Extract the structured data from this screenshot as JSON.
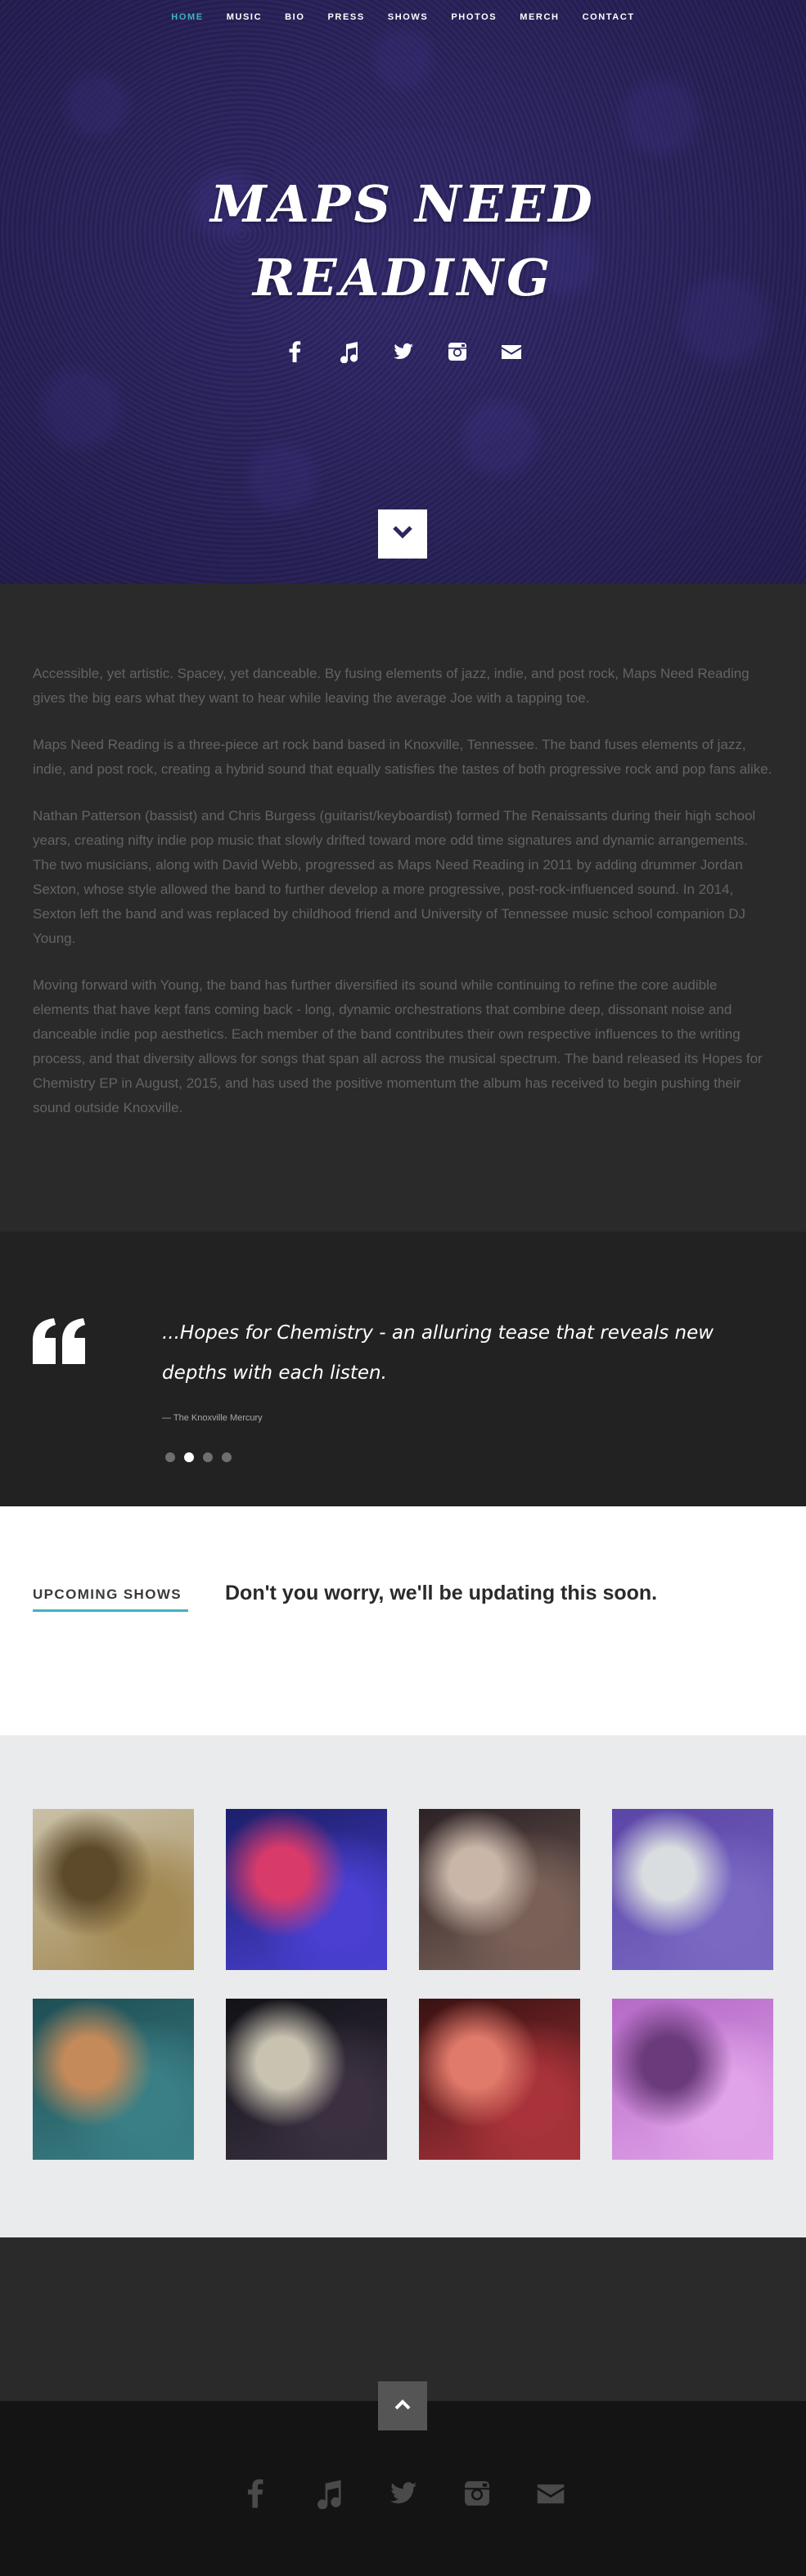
{
  "nav": {
    "items": [
      {
        "label": "HOME",
        "active": true
      },
      {
        "label": "MUSIC"
      },
      {
        "label": "BIO"
      },
      {
        "label": "PRESS"
      },
      {
        "label": "SHOWS"
      },
      {
        "label": "PHOTOS"
      },
      {
        "label": "MERCH"
      },
      {
        "label": "CONTACT"
      }
    ],
    "active_color": "#3fb2c2"
  },
  "hero": {
    "title_line1": "Maps Need",
    "title_line2": "Reading",
    "social_icons": [
      "facebook-icon",
      "music-note-icon",
      "twitter-icon",
      "instagram-icon",
      "envelope-icon"
    ]
  },
  "about": {
    "paragraphs": [
      "Accessible, yet artistic. Spacey, yet danceable. By fusing elements of jazz, indie, and post rock, Maps Need Reading gives the big ears what they want to hear while leaving the average Joe with a tapping toe.",
      "Maps Need Reading is a three-piece art rock band based in Knoxville, Tennessee. The band fuses elements of jazz, indie, and post rock, creating a hybrid sound that equally satisfies the tastes of both progressive rock and pop fans alike.",
      "Nathan Patterson (bassist) and Chris Burgess (guitarist/keyboardist) formed The Renaissants during their high school years, creating nifty indie pop music that slowly drifted toward more odd time signatures and dynamic arrangements. The two musicians, along with David Webb, progressed as Maps Need Reading in 2011 by adding drummer Jordan Sexton, whose style allowed the band to further develop a more progressive, post-rock-influenced sound. In 2014, Sexton left the band and was replaced by childhood friend and University of Tennessee music school companion DJ Young.",
      "Moving forward with Young, the band has further diversified its sound while continuing to refine the core audible elements that have kept fans coming back - long, dynamic orchestrations that combine deep, dissonant noise and danceable indie pop aesthetics. Each member of the band contributes their own respective influences to the writing process, and that diversity allows for songs that span all across the musical spectrum. The band released its Hopes for Chemistry EP in August, 2015, and has used the positive momentum the album has received to begin pushing their sound outside Knoxville."
    ]
  },
  "quote": {
    "text": "...Hopes for Chemistry - an alluring tease that reveals new depths with each listen.",
    "cite": "— The Knoxville Mercury",
    "dot_count": 4,
    "active_dot": 2
  },
  "shows": {
    "heading": "UPCOMING SHOWS",
    "message": "Don't you worry, we'll be updating this soon."
  },
  "gallery": {
    "photos": [
      {
        "name": "band-field-photo",
        "colors": [
          "#c9c0a8",
          "#a38a54",
          "#5d4a2a"
        ]
      },
      {
        "name": "live-blue-stage-photo",
        "colors": [
          "#1c1f6b",
          "#4a3fd1",
          "#d83a6a"
        ]
      },
      {
        "name": "guitarist-closeup-photo",
        "colors": [
          "#2c2226",
          "#7a6158",
          "#c9b6a8"
        ]
      },
      {
        "name": "merch-shirts-photo",
        "colors": [
          "#5b45a8",
          "#7a68c2",
          "#d9dde0"
        ]
      },
      {
        "name": "guitar-on-rug-photo",
        "colors": [
          "#1e4f55",
          "#3a7f85",
          "#c48a5a"
        ]
      },
      {
        "name": "live-bar-stage-photo",
        "colors": [
          "#121218",
          "#3a3040",
          "#c8c2b0"
        ]
      },
      {
        "name": "red-stage-gear-photo",
        "colors": [
          "#3a1212",
          "#a8333a",
          "#e07a6a"
        ]
      },
      {
        "name": "pink-live-photo",
        "colors": [
          "#b56ac7",
          "#e0a2e8",
          "#6a3a7a"
        ]
      }
    ]
  },
  "footer": {
    "social_icons": [
      "facebook-icon",
      "music-note-icon",
      "twitter-icon",
      "instagram-icon",
      "envelope-icon"
    ]
  },
  "colors": {
    "accent": "#3fb2c2",
    "hero_purple": "#332b6a"
  }
}
